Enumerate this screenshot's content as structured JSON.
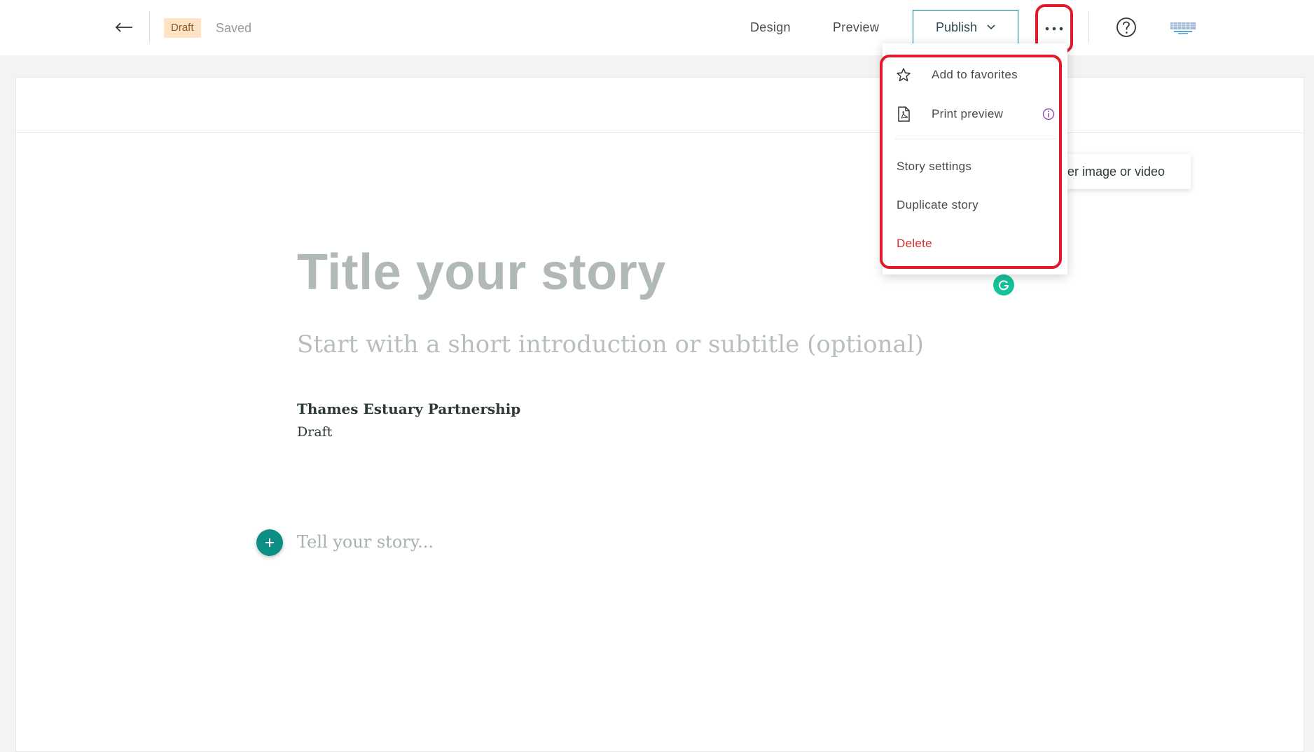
{
  "header": {
    "back_icon": "arrow-left-icon",
    "status_badge": "Draft",
    "save_status": "Saved",
    "nav": {
      "design": "Design",
      "preview": "Preview"
    },
    "publish_label": "Publish",
    "publish_icon": "chevron-down-icon",
    "more_icon": "ellipsis-icon",
    "more_label": "···",
    "help_icon": "question-circle-icon",
    "avatar_icon": "org-logo-icon"
  },
  "colors": {
    "accent": "#007d85",
    "highlight": "#e01a2b",
    "danger": "#d83027",
    "badge_bg": "#fde2c4",
    "add_button": "#0e8f85",
    "grammarly": "#15c39a"
  },
  "menu": {
    "items": [
      {
        "label": "Add to favorites",
        "icon": "star-icon"
      },
      {
        "label": "Print preview",
        "icon": "pdf-icon",
        "trailing_icon": "info-icon"
      },
      {
        "label": "Story settings"
      },
      {
        "label": "Duplicate story"
      },
      {
        "label": "Delete"
      }
    ]
  },
  "story": {
    "title_placeholder": "Title your story",
    "subtitle_placeholder": "Start with a short introduction or subtitle (optional)",
    "author": "Thames Estuary Partnership",
    "author_status": "Draft",
    "body_placeholder": "Tell your story...",
    "add_block_icon": "plus-icon",
    "cover_tooltip": "er image or video"
  }
}
